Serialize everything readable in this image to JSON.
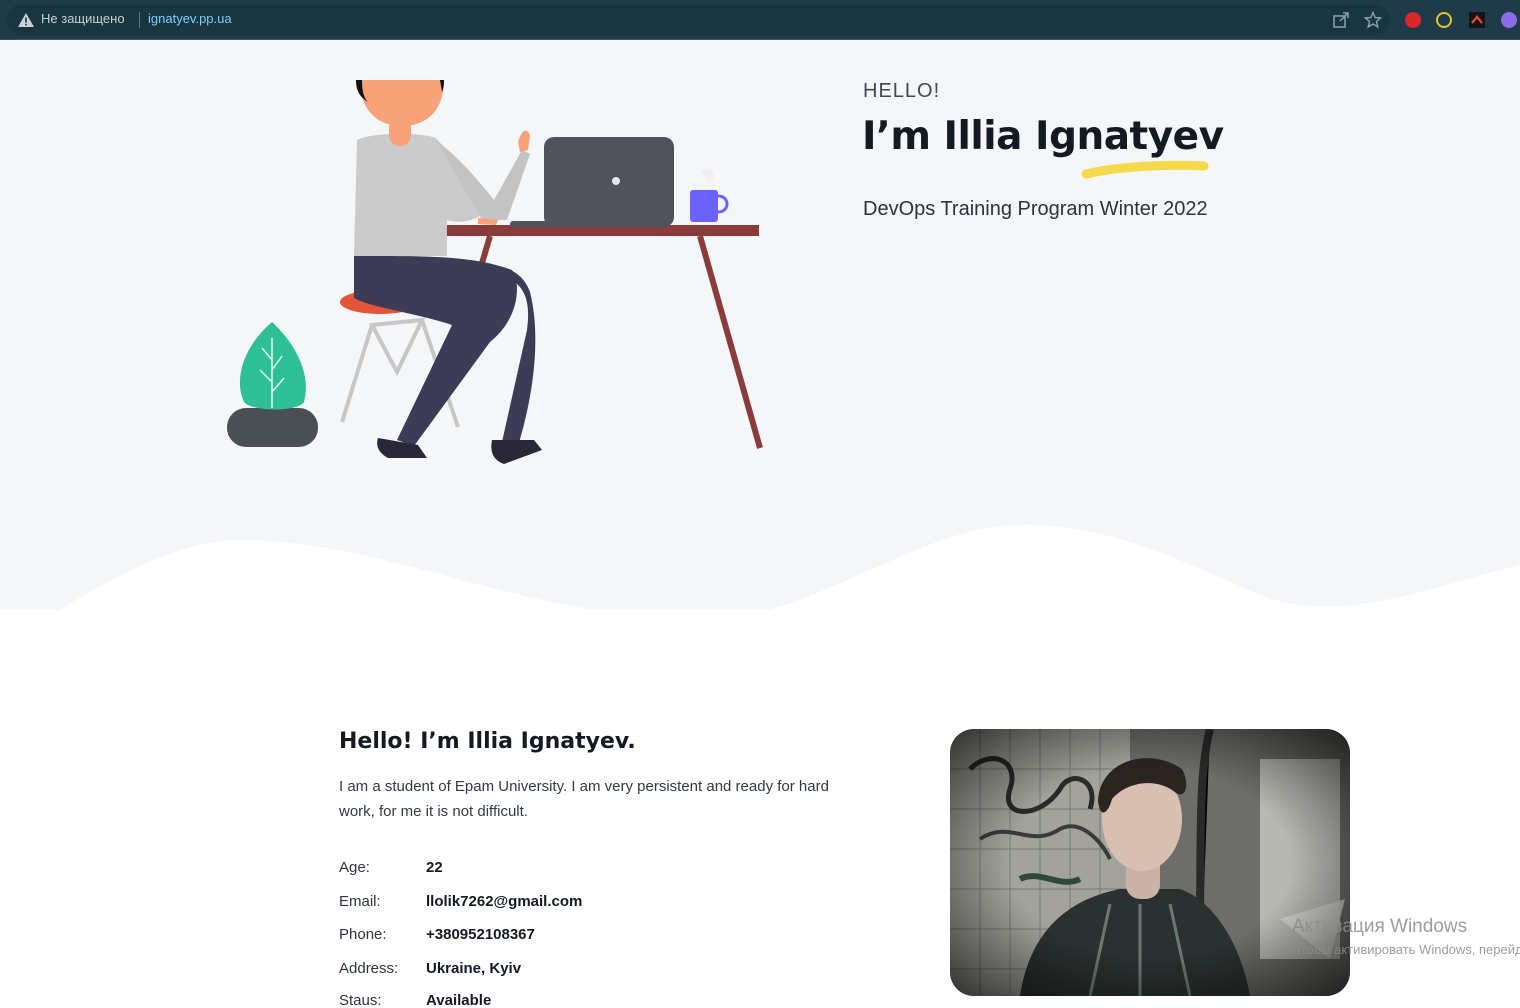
{
  "browser": {
    "security_label": "Не защищено",
    "url": "ignatyev.pp.ua"
  },
  "hero": {
    "greeting": "HELLO!",
    "title": "I’m Illia Ignatyev",
    "subtitle": "DevOps Training Program Winter 2022"
  },
  "about": {
    "title": "Hello! I’m Illia Ignatyev.",
    "description": "I am a student of Epam University. I am very persistent and ready for hard work, for me it is not difficult.",
    "info": [
      {
        "label": "Age:",
        "value": "22"
      },
      {
        "label": "Email:",
        "value": "llolik7262@gmail.com"
      },
      {
        "label": "Phone:",
        "value": "+380952108367"
      },
      {
        "label": "Address:",
        "value": "Ukraine, Kyiv"
      },
      {
        "label": "Staus:",
        "value": "Available"
      }
    ]
  },
  "watermark": {
    "title": "Активация Windows",
    "subtitle": "Чтобы активировать Windows, перейдите"
  },
  "icons": {
    "warning": "warning-icon",
    "share": "share-icon",
    "bookmark": "star-icon",
    "extensions": [
      "ublock-icon",
      "extension-yellow-icon",
      "extension-red-icon",
      "extension-purple-icon"
    ]
  },
  "colors": {
    "browser_bar": "#1f3b47",
    "hero_bg": "#f4f6f8",
    "highlight": "#f5d94a",
    "url": "#79d0ff"
  }
}
